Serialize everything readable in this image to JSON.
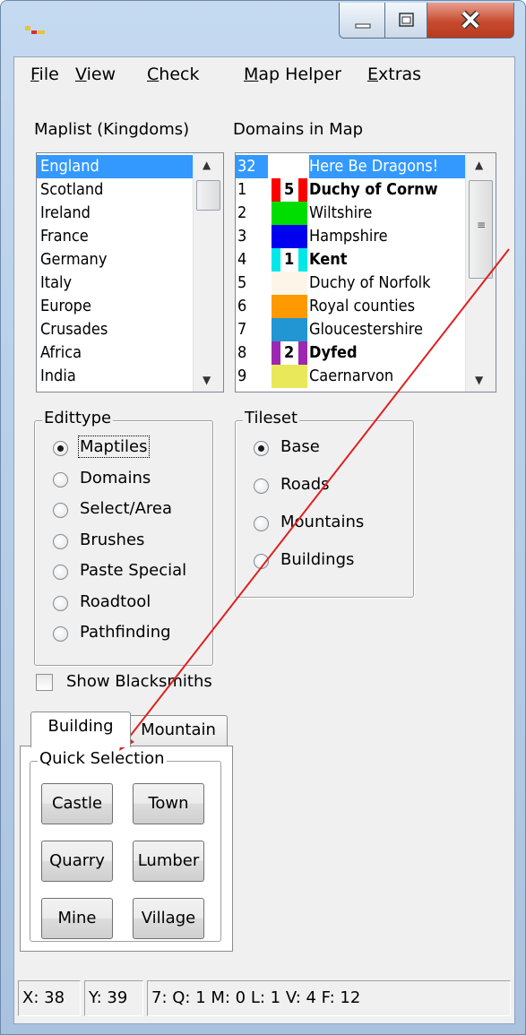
{
  "window": {
    "title": ""
  },
  "menu": [
    {
      "label": "File",
      "accel": "F",
      "rest": "ile"
    },
    {
      "label": "View",
      "accel": "V",
      "rest": "iew"
    },
    {
      "label": "Check",
      "accel": "C",
      "rest": "heck"
    },
    {
      "label": "Map Helper",
      "accel": "M",
      "rest": "ap Helper"
    },
    {
      "label": "Extras",
      "accel": "E",
      "rest": "xtras"
    }
  ],
  "maplist": {
    "label": "Maplist (Kingdoms)",
    "selected": "England",
    "items": [
      "England",
      "Scotland",
      "Ireland",
      "France",
      "Germany",
      "Italy",
      "Europe",
      "Crusades",
      "Africa",
      "India"
    ]
  },
  "domains": {
    "label": "Domains in Map",
    "selected_index": 0,
    "rows": [
      {
        "id": "32",
        "num": "",
        "name": "Here Be Dragons!",
        "color": "#ffffff",
        "bold": false
      },
      {
        "id": "1",
        "num": "5",
        "name": "Duchy of Cornw",
        "color": "#ff0000",
        "bold": true
      },
      {
        "id": "2",
        "num": "",
        "name": "Wiltshire",
        "color": "#00dd00",
        "bold": false
      },
      {
        "id": "3",
        "num": "",
        "name": "Hampshire",
        "color": "#0000ee",
        "bold": false
      },
      {
        "id": "4",
        "num": "1",
        "name": "Kent",
        "color": "#00e8e8",
        "bold": true
      },
      {
        "id": "5",
        "num": "",
        "name": "Duchy of Norfolk",
        "color": "#fdf6e8",
        "bold": false
      },
      {
        "id": "6",
        "num": "",
        "name": "Royal counties",
        "color": "#ff9900",
        "bold": false
      },
      {
        "id": "7",
        "num": "",
        "name": "Gloucestershire",
        "color": "#2196d3",
        "bold": false
      },
      {
        "id": "8",
        "num": "2",
        "name": "Dyfed",
        "color": "#9c27b0",
        "bold": true
      },
      {
        "id": "9",
        "num": "",
        "name": "Caernarvon",
        "color": "#e8e85a",
        "bold": false
      }
    ]
  },
  "edittype": {
    "title": "Edittype",
    "selected": "Maptiles",
    "options": [
      "Maptiles",
      "Domains",
      "Select/Area",
      "Brushes",
      "Paste Special",
      "Roadtool",
      "Pathfinding"
    ]
  },
  "tileset": {
    "title": "Tileset",
    "selected": "Base",
    "options": [
      "Base",
      "Roads",
      "Mountains",
      "Buildings"
    ]
  },
  "show_blacksmiths": {
    "label": "Show Blacksmiths",
    "checked": false
  },
  "tabs": [
    {
      "label": "Building",
      "active": true
    },
    {
      "label": "Mountain",
      "active": false
    }
  ],
  "quick_selection": {
    "title": "Quick Selection",
    "buttons": [
      "Castle",
      "Town",
      "Quarry",
      "Lumber",
      "Mine",
      "Village"
    ]
  },
  "status": {
    "x": "X: 38",
    "y": "Y: 39",
    "info": "7: Q: 1 M: 0 L: 1 V: 4 F: 12"
  },
  "colors": {
    "selection": "#3399ff",
    "annotation_arrow": "#e02020",
    "close_button": "#c74a2e"
  }
}
